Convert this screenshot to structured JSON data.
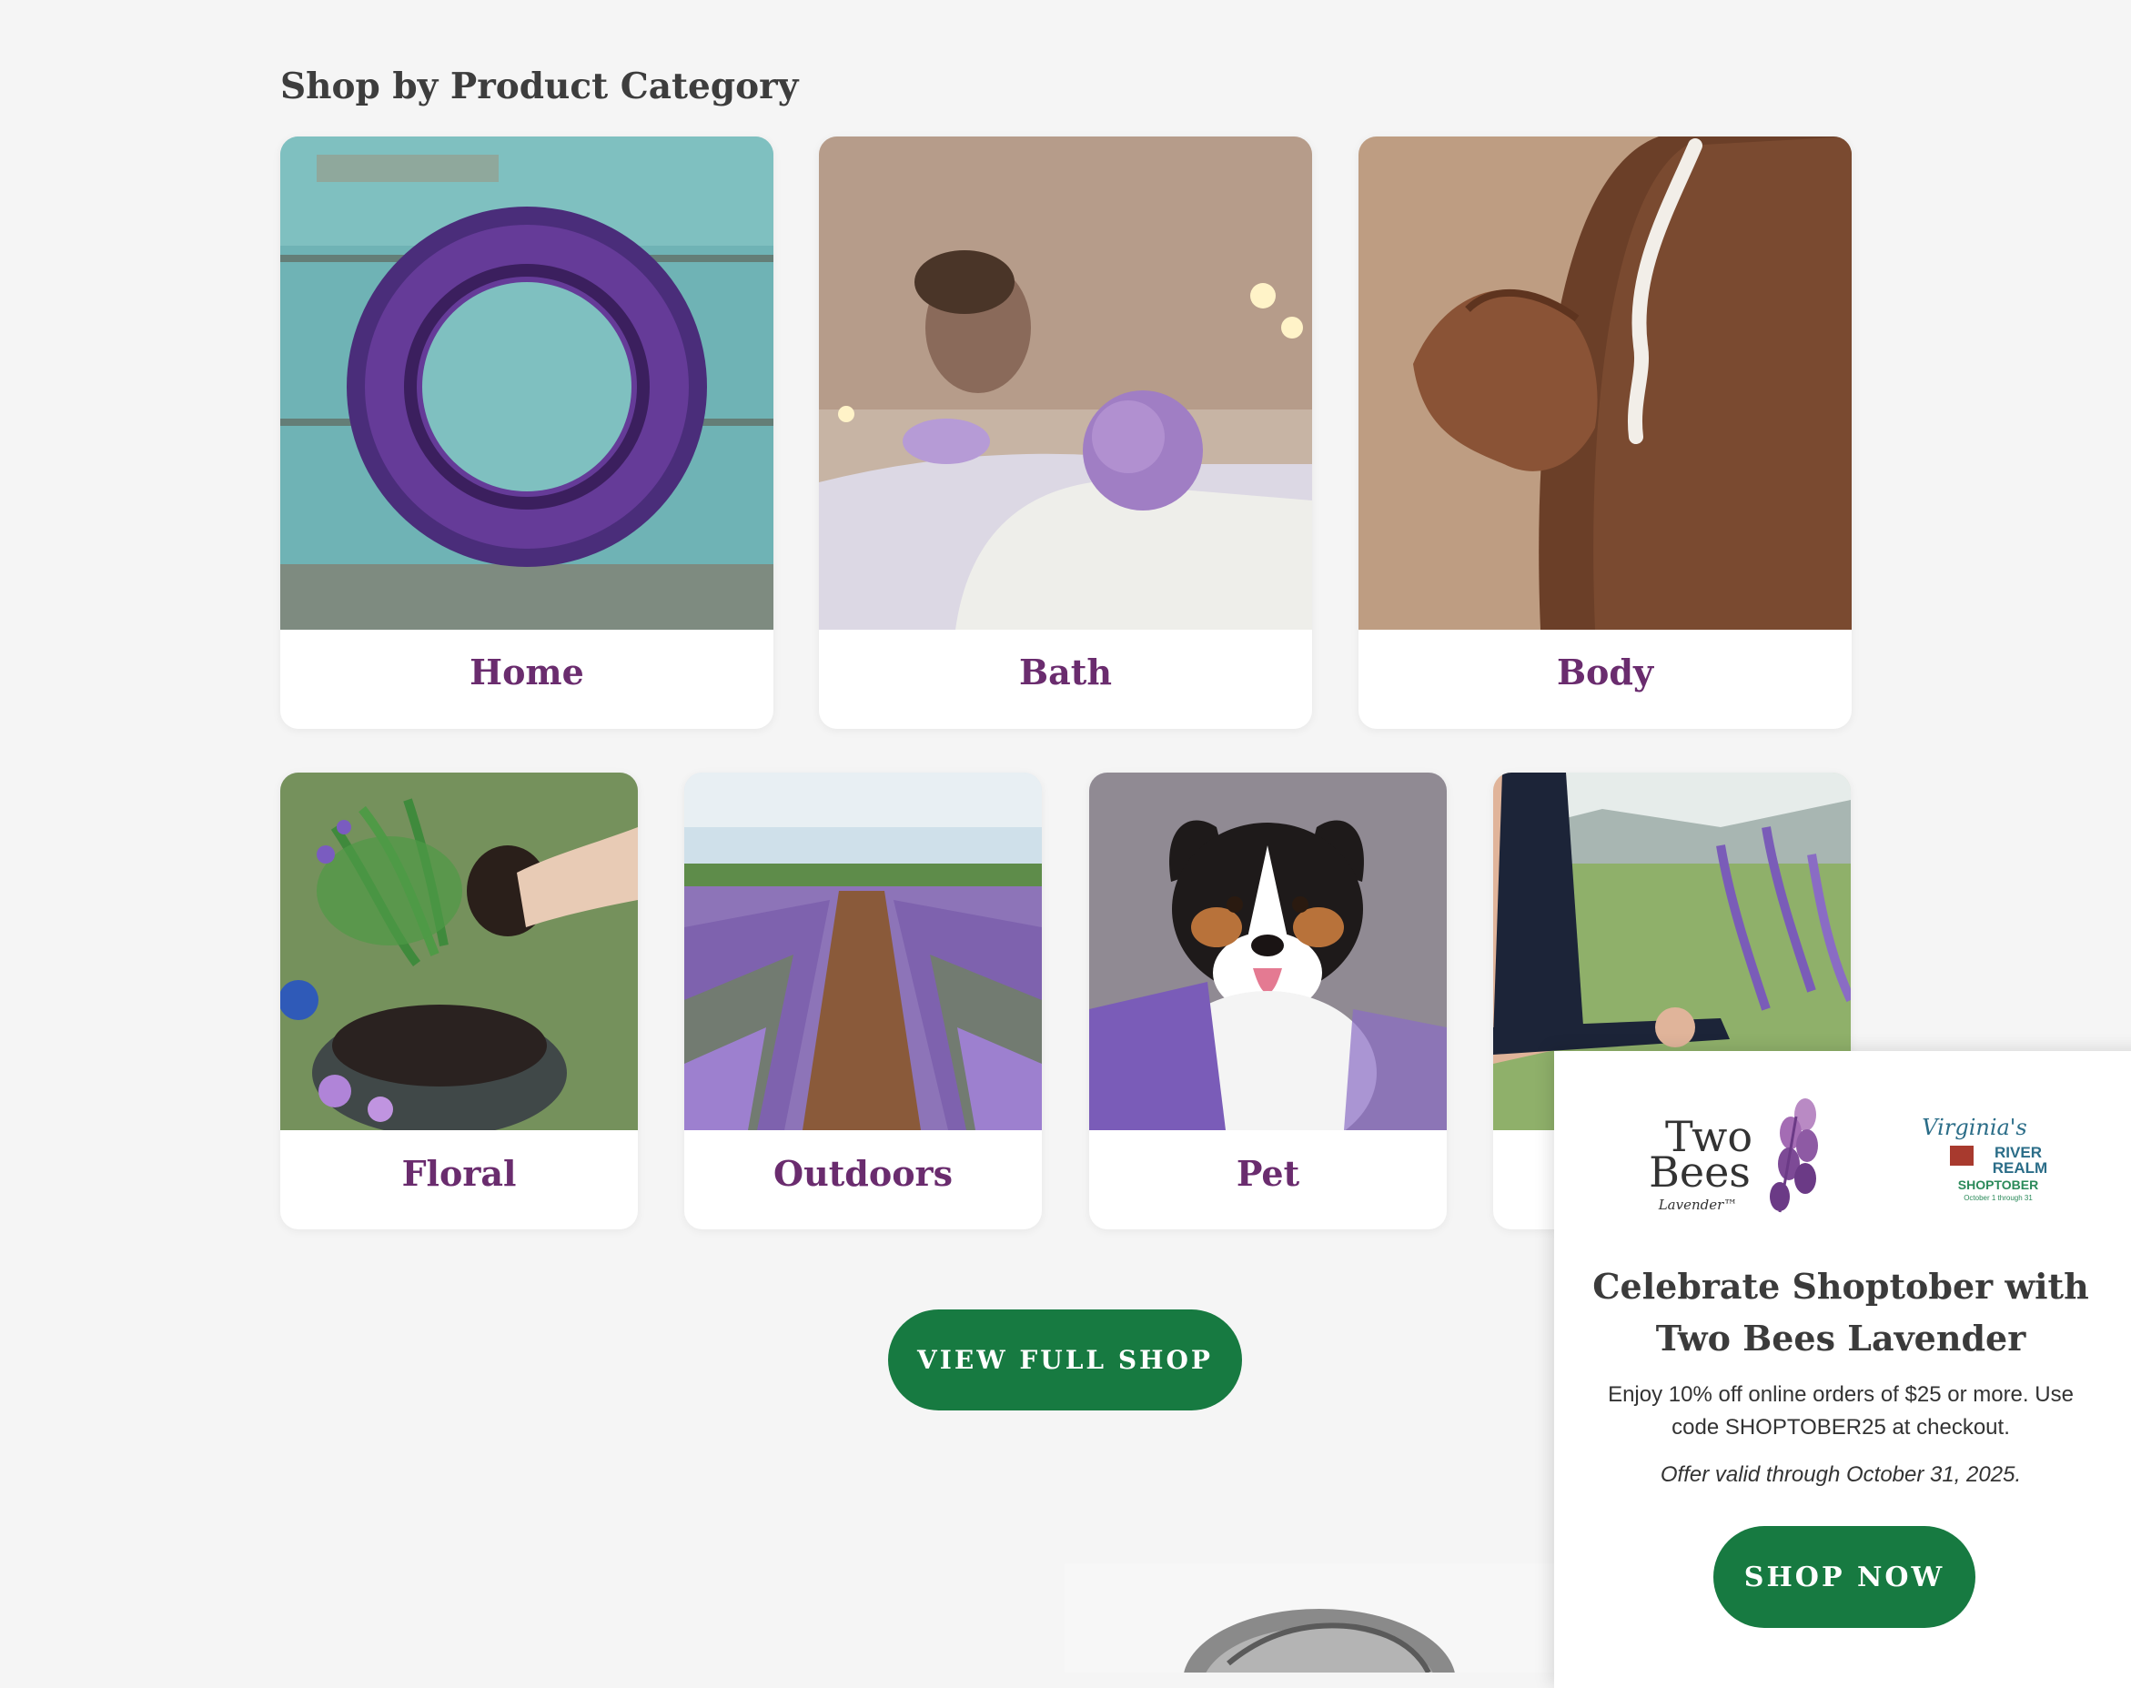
{
  "section": {
    "heading": "Shop by Product Category"
  },
  "categories": [
    {
      "label": "Home",
      "image": "lavender-wreath-photo"
    },
    {
      "label": "Bath",
      "image": "bath-bomb-photo"
    },
    {
      "label": "Body",
      "image": "lotion-shoulder-photo"
    },
    {
      "label": "Floral",
      "image": "potted-lavender-photo"
    },
    {
      "label": "Outdoors",
      "image": "lavender-field-photo"
    },
    {
      "label": "Pet",
      "image": "dog-lavender-photo"
    },
    {
      "label": "",
      "image": "yoga-lavender-photo"
    }
  ],
  "view_full_shop": {
    "label": "VIEW FULL SHOP"
  },
  "popup": {
    "logo_brand": {
      "line1": "Two",
      "line2": "Bees",
      "line3": "Lavender™"
    },
    "logo_partner": {
      "line1": "Virginia's",
      "line2": "RIVER",
      "line3": "REALM",
      "line4": "SHOPTOBER",
      "line5": "October 1 through 31"
    },
    "title": "Celebrate Shoptober with Two Bees Lavender",
    "description": "Enjoy 10% off online orders of $25 or more. Use code SHOPTOBER25 at checkout.",
    "valid": "Offer valid through October 31, 2025.",
    "cta": "SHOP NOW"
  },
  "colors": {
    "brand_green": "#177a41",
    "category_purple": "#6a2c6e",
    "background": "#f5f5f5"
  }
}
